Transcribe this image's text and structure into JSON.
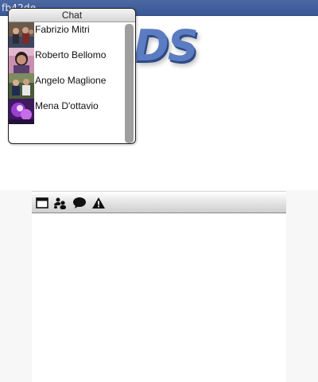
{
  "window": {
    "title": "fb42de"
  },
  "logo": {
    "text": "DS"
  },
  "chat": {
    "header": "Chat",
    "contacts": [
      {
        "name": "Fabrizio Mitri",
        "avatar": "group-photo-avatar"
      },
      {
        "name": "Roberto Bellomo",
        "avatar": "person-photo-avatar"
      },
      {
        "name": "Angelo Maglione",
        "avatar": "group-photo-avatar"
      },
      {
        "name": "Mena D'ottavio",
        "avatar": "purple-photo-avatar"
      }
    ]
  },
  "toolbar": {
    "buttons": [
      {
        "icon": "window-icon"
      },
      {
        "icon": "people-icon"
      },
      {
        "icon": "speech-bubble-icon"
      },
      {
        "icon": "warning-icon"
      }
    ]
  },
  "colors": {
    "title_bar": "#3a5896",
    "logo": "#5c7cc2",
    "scrollbar_thumb": "#9e9e9e"
  }
}
